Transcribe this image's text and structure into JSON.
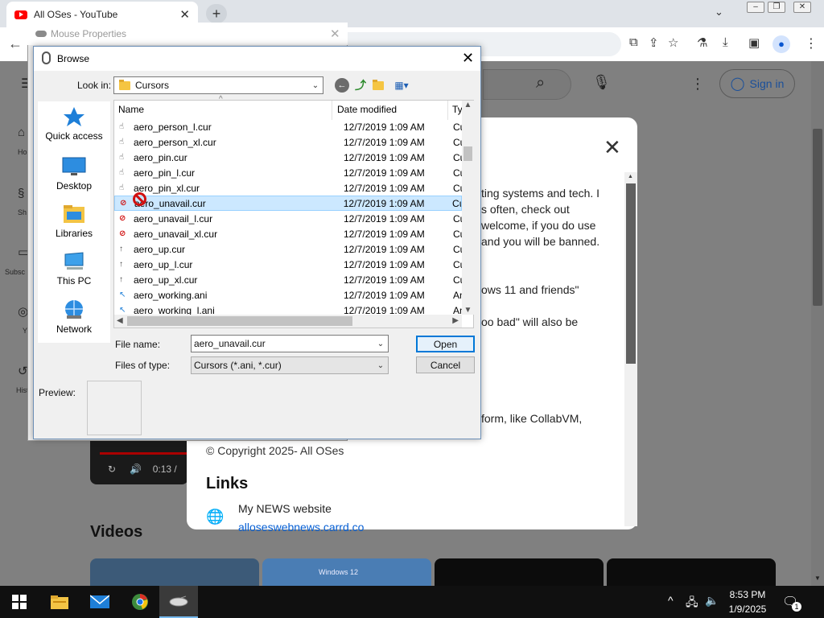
{
  "browser": {
    "tab_title": "All OSes - YouTube",
    "new_tab_symbol": "+",
    "close_symbol": "✕",
    "icons": [
      "youtube-favicon",
      "back-icon",
      "cast-icon",
      "share-icon",
      "bookmark-star-icon",
      "labs-icon",
      "download-icon",
      "sidepanel-icon",
      "profile-icon",
      "menu-icon"
    ]
  },
  "youtube": {
    "sign_in_label": "Sign in",
    "sidebar_labels": [
      "Ho",
      "Sh",
      "Subsc",
      "Y",
      "Histo"
    ],
    "video_time": "0:13 /",
    "videos_heading": "Videos",
    "thumb_text": "Windows 12"
  },
  "about_modal": {
    "lines": [
      "ting systems and tech. I",
      "s often, check out",
      "welcome, if you do use",
      "and you will be banned.",
      "ows 11 and friends\"",
      "oo bad\" will also be",
      "form, like CollabVM,"
    ],
    "copyright": "© Copyright 2025- All OSes",
    "links_heading": "Links",
    "link_title": "My NEWS website",
    "link_url": "alloseswebnews.carrd.co"
  },
  "mouse_properties": {
    "title": "Mouse Properties"
  },
  "browse_dialog": {
    "title": "Browse",
    "look_in_label": "Look in:",
    "look_in_value": "Cursors",
    "places": [
      {
        "label": "Quick access",
        "icon": "star-icon"
      },
      {
        "label": "Desktop",
        "icon": "desktop-icon"
      },
      {
        "label": "Libraries",
        "icon": "libraries-icon"
      },
      {
        "label": "This PC",
        "icon": "computer-icon"
      },
      {
        "label": "Network",
        "icon": "network-icon"
      }
    ],
    "columns": {
      "name": "Name",
      "date": "Date modified",
      "type": "Ty"
    },
    "files": [
      {
        "name": "aero_person_l.cur",
        "date": "12/7/2019 1:09 AM",
        "type": "Cu",
        "icon": "hand-person-icon"
      },
      {
        "name": "aero_person_xl.cur",
        "date": "12/7/2019 1:09 AM",
        "type": "Cu",
        "icon": "hand-person-icon"
      },
      {
        "name": "aero_pin.cur",
        "date": "12/7/2019 1:09 AM",
        "type": "Cu",
        "icon": "hand-pin-icon"
      },
      {
        "name": "aero_pin_l.cur",
        "date": "12/7/2019 1:09 AM",
        "type": "Cu",
        "icon": "hand-pin-icon"
      },
      {
        "name": "aero_pin_xl.cur",
        "date": "12/7/2019 1:09 AM",
        "type": "Cu",
        "icon": "hand-pin-icon"
      },
      {
        "name": "aero_unavail.cur",
        "date": "12/7/2019 1:09 AM",
        "type": "Cu",
        "icon": "unavailable-icon"
      },
      {
        "name": "aero_unavail_l.cur",
        "date": "12/7/2019 1:09 AM",
        "type": "Cu",
        "icon": "unavailable-icon"
      },
      {
        "name": "aero_unavail_xl.cur",
        "date": "12/7/2019 1:09 AM",
        "type": "Cu",
        "icon": "unavailable-icon"
      },
      {
        "name": "aero_up.cur",
        "date": "12/7/2019 1:09 AM",
        "type": "Cu",
        "icon": "up-arrow-icon"
      },
      {
        "name": "aero_up_l.cur",
        "date": "12/7/2019 1:09 AM",
        "type": "Cu",
        "icon": "up-arrow-icon"
      },
      {
        "name": "aero_up_xl.cur",
        "date": "12/7/2019 1:09 AM",
        "type": "Cu",
        "icon": "up-arrow-icon"
      },
      {
        "name": "aero_working.ani",
        "date": "12/7/2019 1:09 AM",
        "type": "An",
        "icon": "working-icon"
      },
      {
        "name": "aero_working_l.ani",
        "date": "12/7/2019 1:09 AM",
        "type": "An",
        "icon": "working-icon"
      }
    ],
    "selected_file": "aero_unavail.cur",
    "file_name_label": "File name:",
    "file_name_value": "aero_unavail.cur",
    "files_of_type_label": "Files of type:",
    "files_of_type_value": "Cursors (*.ani, *.cur)",
    "open_label": "Open",
    "cancel_label": "Cancel",
    "preview_label": "Preview:"
  },
  "taskbar": {
    "time": "8:53 PM",
    "date": "1/9/2025",
    "notification_count": "1",
    "apps": [
      "start-icon",
      "file-explorer-icon",
      "mail-icon",
      "chrome-icon",
      "mouse-properties-icon"
    ]
  },
  "colors": {
    "selection": "#cce8ff",
    "accent": "#0078d7",
    "youtube_red": "#ff0000",
    "unavailable_red": "#d01010"
  }
}
